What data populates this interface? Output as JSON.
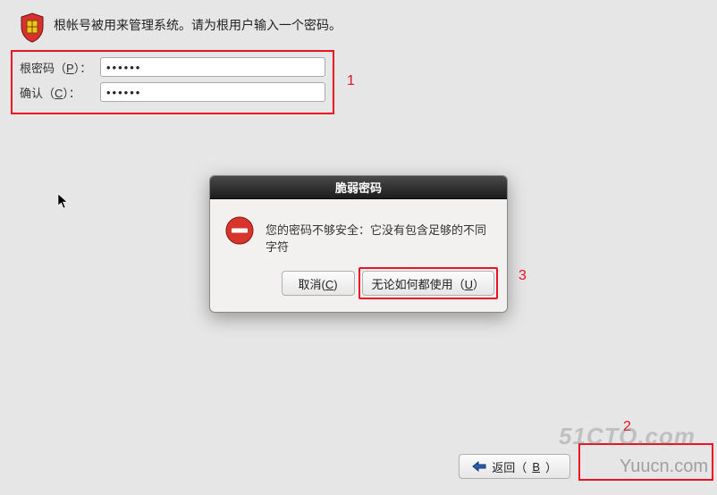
{
  "header": {
    "text": "根帐号被用来管理系统。请为根用户输入一个密码。"
  },
  "password": {
    "root_label_pre": "根密码（",
    "root_label_key": "P",
    "root_label_post": "）：",
    "root_value": "••••••",
    "confirm_label_pre": "确认（",
    "confirm_label_key": "C",
    "confirm_label_post": "）：",
    "confirm_value": "••••••"
  },
  "dialog": {
    "title": "脆弱密码",
    "message": "您的密码不够安全：它没有包含足够的不同字符",
    "cancel_pre": "取消(",
    "cancel_key": "C",
    "cancel_post": ")",
    "use_pre": "无论如何都使用（",
    "use_key": "U",
    "use_post": "）"
  },
  "footer": {
    "back_pre": "返回（",
    "back_key": "B",
    "back_post": "）"
  },
  "annotations": {
    "a1": "1",
    "a2": "2",
    "a3": "3"
  },
  "watermarks": {
    "w1": "51CTO.com",
    "w2": "Yuucn.com"
  }
}
